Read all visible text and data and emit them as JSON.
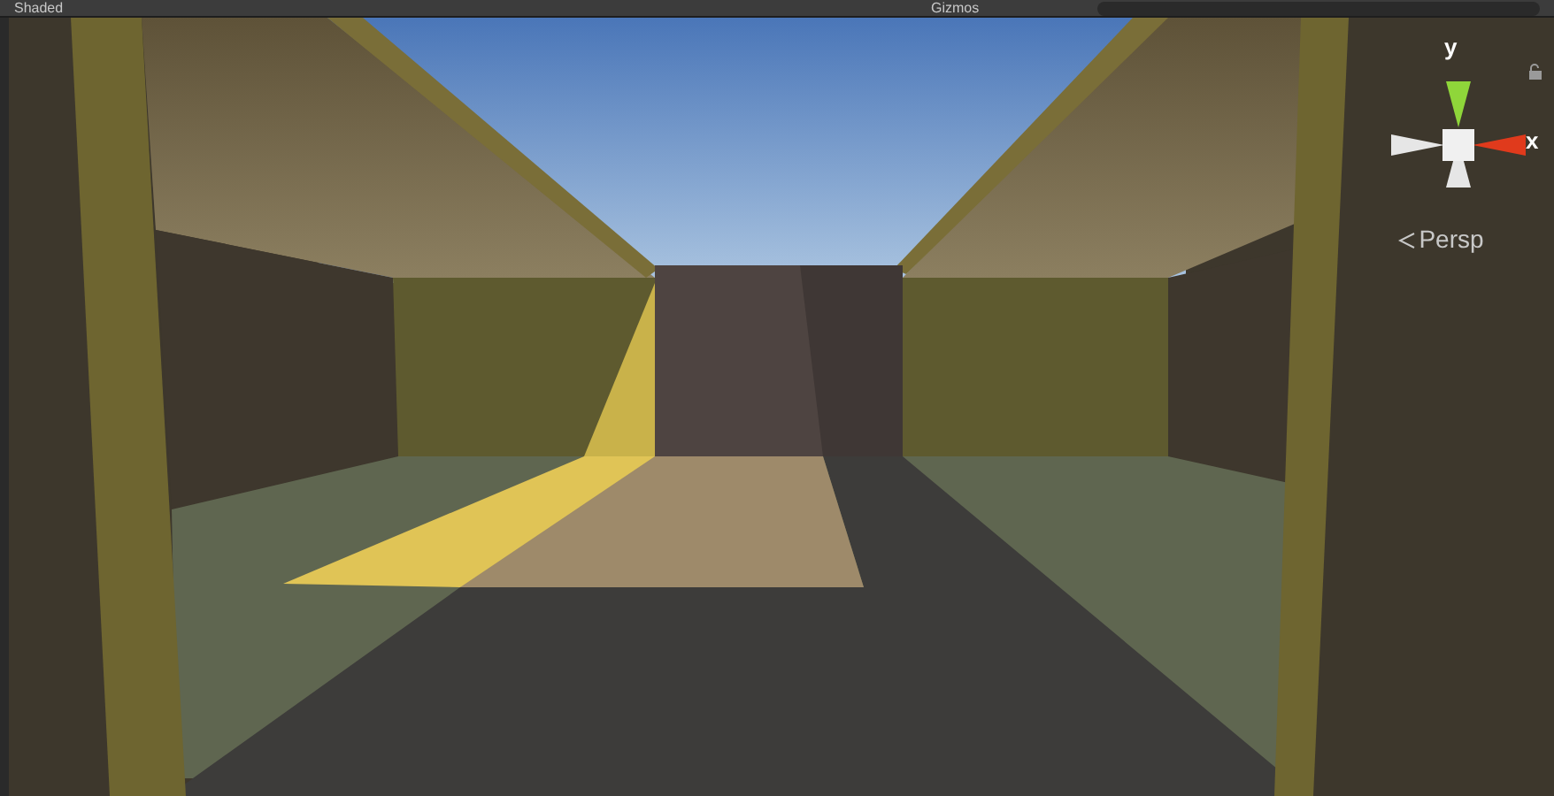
{
  "toolbar": {
    "shading_mode": "Shaded",
    "gizmos": "Gizmos"
  },
  "orientation_gizmo": {
    "y_axis": "y",
    "x_axis": "x",
    "projection": "Persp"
  }
}
